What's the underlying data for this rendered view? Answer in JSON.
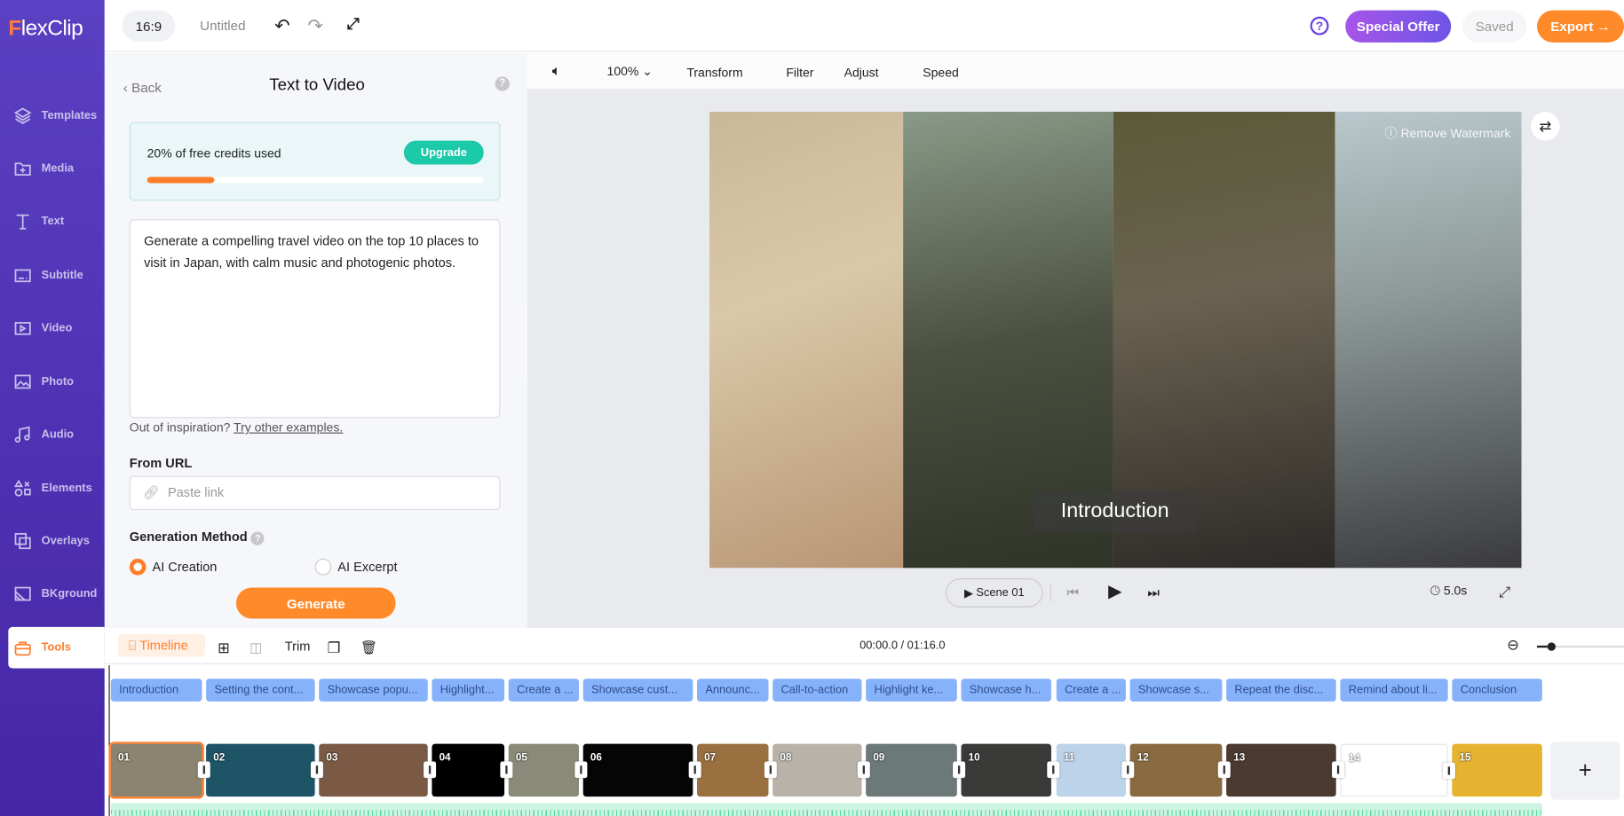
{
  "app": {
    "logo": "FlexClip",
    "aspect": "16:9",
    "title": "Untitled"
  },
  "topbar": {
    "special_offer": "Special Offer",
    "saved": "Saved",
    "export": "Export →"
  },
  "sidebar": {
    "items": [
      {
        "label": "Templates",
        "icon": "layers-icon"
      },
      {
        "label": "Media",
        "icon": "folder-plus-icon"
      },
      {
        "label": "Text",
        "icon": "text-icon"
      },
      {
        "label": "Subtitle",
        "icon": "subtitle-icon"
      },
      {
        "label": "Video",
        "icon": "video-icon"
      },
      {
        "label": "Photo",
        "icon": "photo-icon"
      },
      {
        "label": "Audio",
        "icon": "music-icon"
      },
      {
        "label": "Elements",
        "icon": "shapes-icon"
      },
      {
        "label": "Overlays",
        "icon": "overlays-icon"
      },
      {
        "label": "BKground",
        "icon": "background-icon"
      },
      {
        "label": "Tools",
        "icon": "toolbox-icon",
        "active": true
      }
    ]
  },
  "panel": {
    "back": "Back",
    "title": "Text to Video",
    "credits_text": "20% of free credits used",
    "credits_used_percent": 20,
    "upgrade": "Upgrade",
    "prompt": "Generate a compelling travel video on the top 10 places to visit in Japan, with calm music and photogenic photos.",
    "inspiration": "Out of inspiration?",
    "try_examples": "Try other examples.",
    "url_label": "From URL",
    "url_placeholder": "Paste link",
    "method_label": "Generation Method",
    "methods": [
      {
        "label": "AI Creation",
        "selected": true
      },
      {
        "label": "AI Excerpt",
        "selected": false
      }
    ],
    "generate": "Generate"
  },
  "preview_toolbar": {
    "zoom": "100%",
    "transform": "Transform",
    "filter": "Filter",
    "adjust": "Adjust",
    "speed": "Speed"
  },
  "preview": {
    "watermark": "Remove Watermark",
    "caption": "Introduction",
    "scene": "Scene 01",
    "duration": "5.0s"
  },
  "timeline": {
    "label": "Timeline",
    "trim": "Trim",
    "time": "00:00.0 / 01:16.0",
    "scenes": [
      "Introduction",
      "Setting the cont...",
      "Showcase popu...",
      "Highlight...",
      "Create a ...",
      "Showcase cust...",
      "Announc...",
      "Call-to-action",
      "Highlight ke...",
      "Showcase h...",
      "Create a ...",
      "Showcase s...",
      "Repeat the disc...",
      "Remind about li...",
      "Conclusion"
    ],
    "clips": [
      {
        "num": "01",
        "color": "#8a8470"
      },
      {
        "num": "02",
        "color": "#1d5566"
      },
      {
        "num": "03",
        "color": "#7a5a44"
      },
      {
        "num": "04",
        "color": "#000000"
      },
      {
        "num": "05",
        "color": "#8a8a78"
      },
      {
        "num": "06",
        "color": "#050505"
      },
      {
        "num": "07",
        "color": "#9a7040"
      },
      {
        "num": "08",
        "color": "#b9b2a8"
      },
      {
        "num": "09",
        "color": "#6b7a78"
      },
      {
        "num": "10",
        "color": "#3a3a38"
      },
      {
        "num": "11",
        "color": "#bcd3ea"
      },
      {
        "num": "12",
        "color": "#8a6a40"
      },
      {
        "num": "13",
        "color": "#4a3a30"
      },
      {
        "num": "14",
        "color": "#ffffff"
      },
      {
        "num": "15",
        "color": "#e5b330"
      }
    ],
    "accent": "#ff7d2a"
  }
}
